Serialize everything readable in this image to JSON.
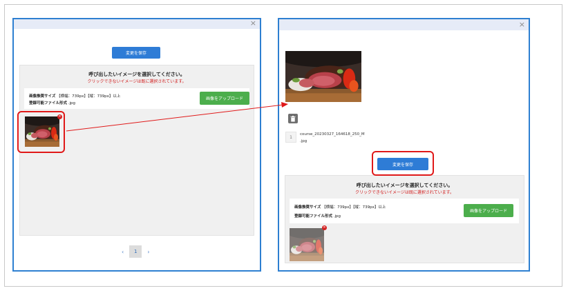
{
  "close_glyph": "×",
  "save_label": "変更を保存",
  "upload_label": "画像をアップロード",
  "heading": "呼び出したいイメージを選択してください。",
  "warning": "クリックできないイメージは既に選択されています。",
  "recommended_size_label": "画像推奨サイズ",
  "recommended_size_value": "【横幅：739px】【縦：739px】以上",
  "allowed_format_label": "登録可能ファイル形式",
  "allowed_format_value": ".jpg",
  "pagination": {
    "prev": "‹",
    "current": "1",
    "next": "›"
  },
  "selected_image": {
    "index": "1",
    "filename_line1": "course_20230327_164618_250_M",
    "filename_line2": ".jpg"
  },
  "colors": {
    "accent": "#2e7cd6",
    "upload": "#4cae4c",
    "highlight": "#e01818",
    "modal_border": "#2d7fd1"
  },
  "icons": [
    "close-icon",
    "delete-icon",
    "trash-icon",
    "chevron-left-icon",
    "chevron-right-icon",
    "arrow-icon"
  ]
}
